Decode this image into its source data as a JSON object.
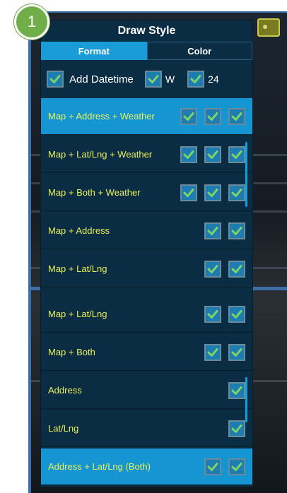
{
  "badge": {
    "number": "1"
  },
  "dialog": {
    "title": "Draw Style",
    "tabs": [
      {
        "label": "Format",
        "active": true
      },
      {
        "label": "Color",
        "active": false
      }
    ],
    "options": [
      {
        "label": "Add Datetime",
        "checked": true
      },
      {
        "label": "W",
        "checked": true
      },
      {
        "label": "24",
        "checked": true
      }
    ]
  },
  "list_top": [
    {
      "label": "Map + Address + Weather",
      "checks": 3,
      "selected": true
    },
    {
      "label": "Map + Lat/Lng + Weather",
      "checks": 3,
      "selected": false
    },
    {
      "label": "Map + Both + Weather",
      "checks": 3,
      "selected": false
    },
    {
      "label": "Map + Address",
      "checks": 2,
      "selected": false
    },
    {
      "label": "Map + Lat/Lng",
      "checks": 2,
      "selected": false
    }
  ],
  "list_bottom": [
    {
      "label": "Map + Lat/Lng",
      "checks": 2,
      "selected": false
    },
    {
      "label": "Map + Both",
      "checks": 2,
      "selected": false
    },
    {
      "label": "Address",
      "checks": 1,
      "selected": false
    },
    {
      "label": "Lat/Lng",
      "checks": 1,
      "selected": false
    },
    {
      "label": "Address + Lat/Lng (Both)",
      "checks": 2,
      "selected": true
    }
  ],
  "colors": {
    "accent": "#1596d2",
    "panel": "#0b2d44",
    "label_yellow": "#e9f05a",
    "check_green": "#7cd36a",
    "frame_blue": "#3d6ea4",
    "badge_green": "#6fae48"
  }
}
